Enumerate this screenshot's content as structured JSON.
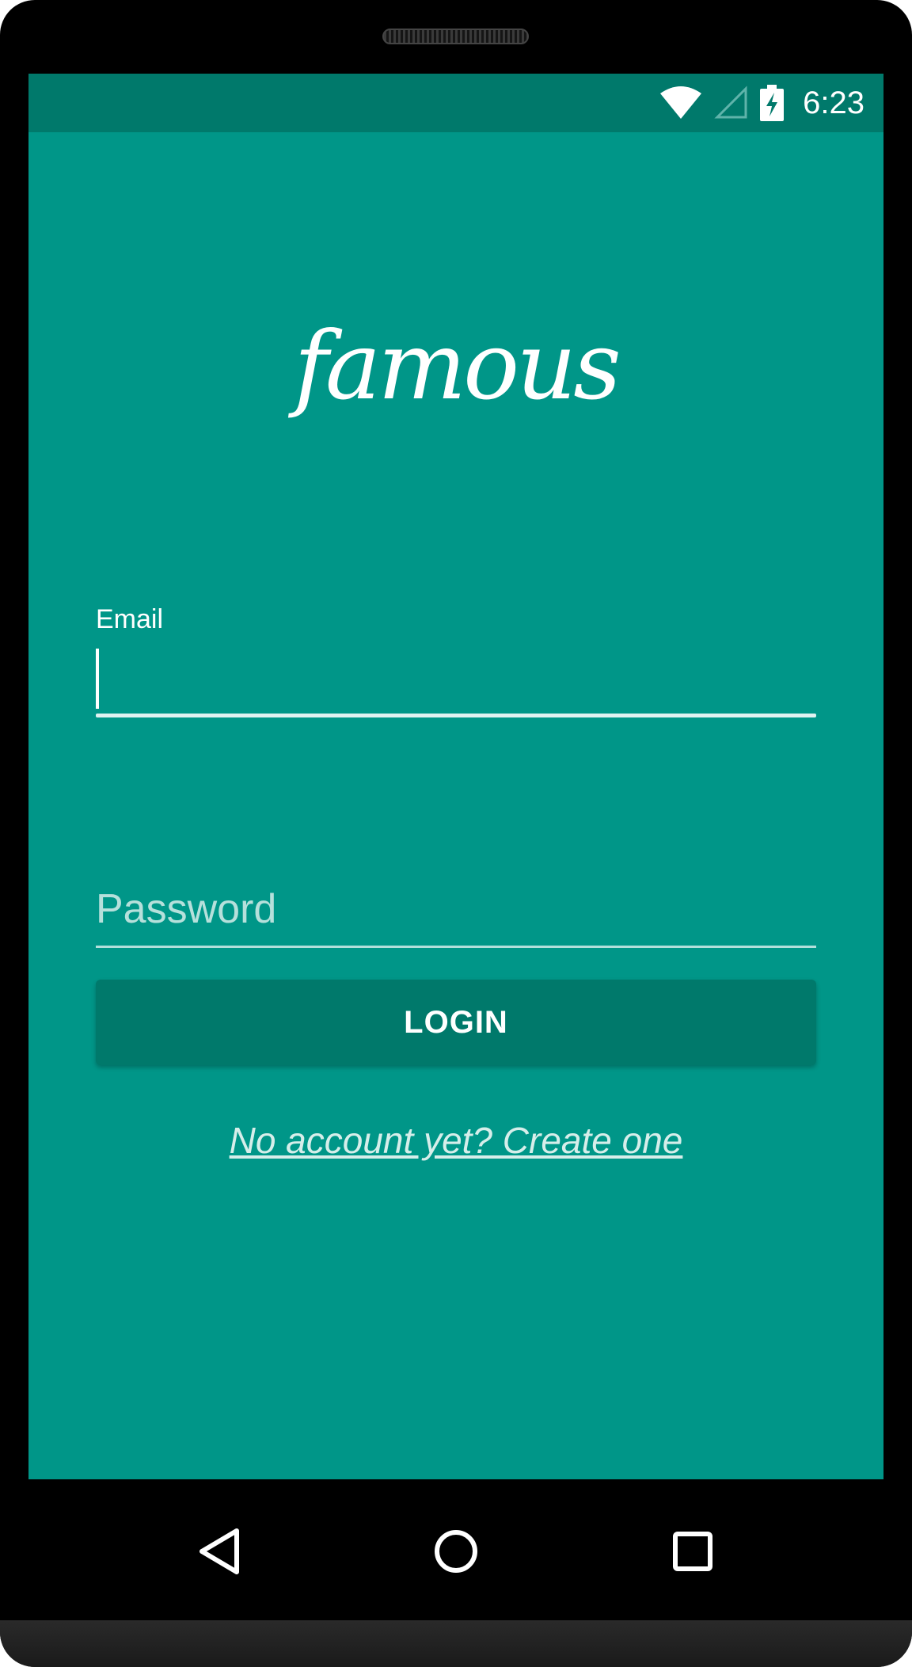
{
  "status_bar": {
    "time": "6:23",
    "wifi_icon": "wifi-icon",
    "signal_icon": "cell-signal-empty-icon",
    "battery_icon": "battery-charging-icon"
  },
  "app": {
    "logo_text": "famous",
    "email_label": "Email",
    "email_value": "",
    "password_placeholder": "Password",
    "login_label": "LOGIN",
    "create_account_link": "No account yet? Create one"
  },
  "nav_bar": {
    "back_icon": "back-triangle-icon",
    "home_icon": "home-circle-icon",
    "recents_icon": "recents-square-icon"
  },
  "colors": {
    "primary": "#009688",
    "primary_dark": "#00796B",
    "accent_text": "#ffffff"
  }
}
